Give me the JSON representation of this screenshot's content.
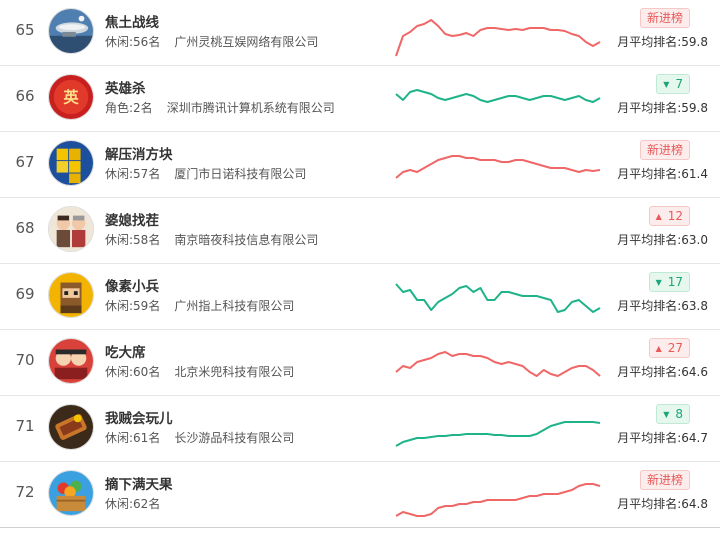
{
  "colors": {
    "red_line": "#f06767",
    "green_line": "#1fb38a",
    "up": "#e85a5a",
    "down": "#1aa57a"
  },
  "rows": [
    {
      "rank": "65",
      "name": "焦土战线",
      "category": "休闲:56名",
      "company": "广州灵桃互娱网络有限公司",
      "badge_type": "new",
      "badge_text": "新进榜",
      "avg": "月平均排名:59.8",
      "trend_color": "red",
      "icon": "airship-game-icon",
      "trend": [
        50,
        30,
        26,
        20,
        18,
        14,
        20,
        28,
        30,
        29,
        27,
        30,
        24,
        22,
        22,
        23,
        24,
        23,
        24,
        22,
        22,
        22,
        24,
        24,
        25,
        28,
        30,
        36,
        40,
        36
      ]
    },
    {
      "rank": "66",
      "name": "英雄杀",
      "category": "角色:2名",
      "company": "深圳市腾讯计算机系统有限公司",
      "badge_type": "down",
      "badge_text": "7",
      "avg": "月平均排名:59.8",
      "trend_color": "green",
      "icon": "hero-kill-game-icon",
      "trend": [
        22,
        28,
        20,
        18,
        20,
        22,
        26,
        28,
        26,
        24,
        22,
        24,
        28,
        30,
        28,
        26,
        24,
        24,
        26,
        28,
        26,
        24,
        24,
        26,
        28,
        26,
        24,
        28,
        30,
        26
      ]
    },
    {
      "rank": "67",
      "name": "解压消方块",
      "category": "休闲:57名",
      "company": "厦门市日诺科技有限公司",
      "badge_type": "new",
      "badge_text": "新进榜",
      "avg": "月平均排名:61.4",
      "trend_color": "red",
      "icon": "blocks-game-icon",
      "trend": [
        40,
        34,
        32,
        34,
        30,
        26,
        22,
        20,
        18,
        18,
        20,
        20,
        22,
        22,
        22,
        24,
        24,
        22,
        22,
        24,
        26,
        28,
        30,
        30,
        30,
        32,
        34,
        32,
        33,
        32
      ]
    },
    {
      "rank": "68",
      "name": "婆媳找茬",
      "category": "休闲:58名",
      "company": "南京暗夜科技信息有限公司",
      "badge_type": "up",
      "badge_text": "12",
      "avg": "月平均排名:63.0",
      "trend_color": "red",
      "icon": "family-spot-game-icon",
      "trend": []
    },
    {
      "rank": "69",
      "name": "像素小兵",
      "category": "休闲:59名",
      "company": "广州指上科技有限公司",
      "badge_type": "down",
      "badge_text": "17",
      "avg": "月平均排名:63.8",
      "trend_color": "green",
      "icon": "pixel-soldier-game-icon",
      "trend": [
        14,
        22,
        20,
        30,
        30,
        40,
        32,
        28,
        24,
        18,
        16,
        22,
        18,
        30,
        30,
        22,
        22,
        24,
        26,
        26,
        26,
        28,
        30,
        42,
        40,
        32,
        30,
        36,
        42,
        38
      ]
    },
    {
      "rank": "70",
      "name": "吃大席",
      "category": "休闲:60名",
      "company": "北京米兜科技有限公司",
      "badge_type": "up",
      "badge_text": "27",
      "avg": "月平均排名:64.6",
      "trend_color": "red",
      "icon": "banquet-game-icon",
      "trend": [
        36,
        30,
        32,
        26,
        24,
        22,
        18,
        16,
        20,
        18,
        18,
        20,
        20,
        22,
        26,
        28,
        26,
        28,
        30,
        36,
        40,
        34,
        38,
        40,
        36,
        32,
        30,
        30,
        34,
        40
      ]
    },
    {
      "rank": "71",
      "name": "我贼会玩儿",
      "category": "休闲:61名",
      "company": "长沙游品科技有限公司",
      "badge_type": "down",
      "badge_text": "8",
      "avg": "月平均排名:64.7",
      "trend_color": "green",
      "icon": "tank-game-icon",
      "trend": [
        44,
        40,
        38,
        36,
        36,
        35,
        34,
        34,
        33,
        33,
        32,
        32,
        32,
        32,
        33,
        33,
        34,
        34,
        34,
        34,
        32,
        28,
        24,
        22,
        20,
        20,
        20,
        20,
        20,
        21
      ]
    },
    {
      "rank": "72",
      "name": "摘下满天果",
      "category": "休闲:62名",
      "company": "",
      "badge_type": "new",
      "badge_text": "新进榜",
      "avg": "月平均排名:64.8",
      "trend_color": "red",
      "icon": "fruit-basket-game-icon",
      "trend": [
        48,
        44,
        46,
        48,
        48,
        46,
        40,
        38,
        38,
        36,
        36,
        34,
        34,
        32,
        32,
        32,
        32,
        32,
        30,
        28,
        28,
        26,
        26,
        26,
        24,
        22,
        18,
        16,
        16,
        18
      ]
    }
  ]
}
